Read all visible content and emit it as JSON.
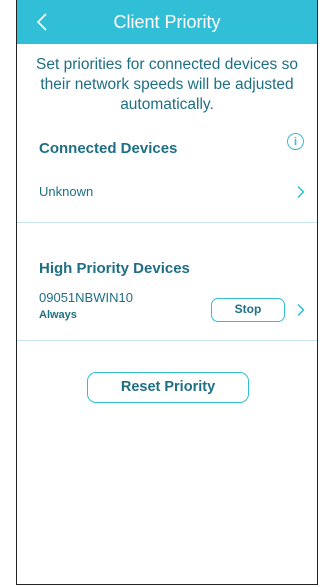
{
  "header": {
    "title": "Client Priority"
  },
  "intro": {
    "text": "Set priorities for connected devices so their network speeds will be adjusted automatically."
  },
  "connected": {
    "title": "Connected Devices",
    "info_icon": "i",
    "items": [
      {
        "label": "Unknown"
      }
    ]
  },
  "high_priority": {
    "title": "High Priority Devices",
    "items": [
      {
        "name": "09051NBWIN10",
        "schedule": "Always",
        "action_label": "Stop"
      }
    ]
  },
  "actions": {
    "reset_label": "Reset Priority"
  },
  "colors": {
    "accent": "#30bfd6",
    "text": "#1f6f84",
    "divider": "#c7e4ec"
  }
}
